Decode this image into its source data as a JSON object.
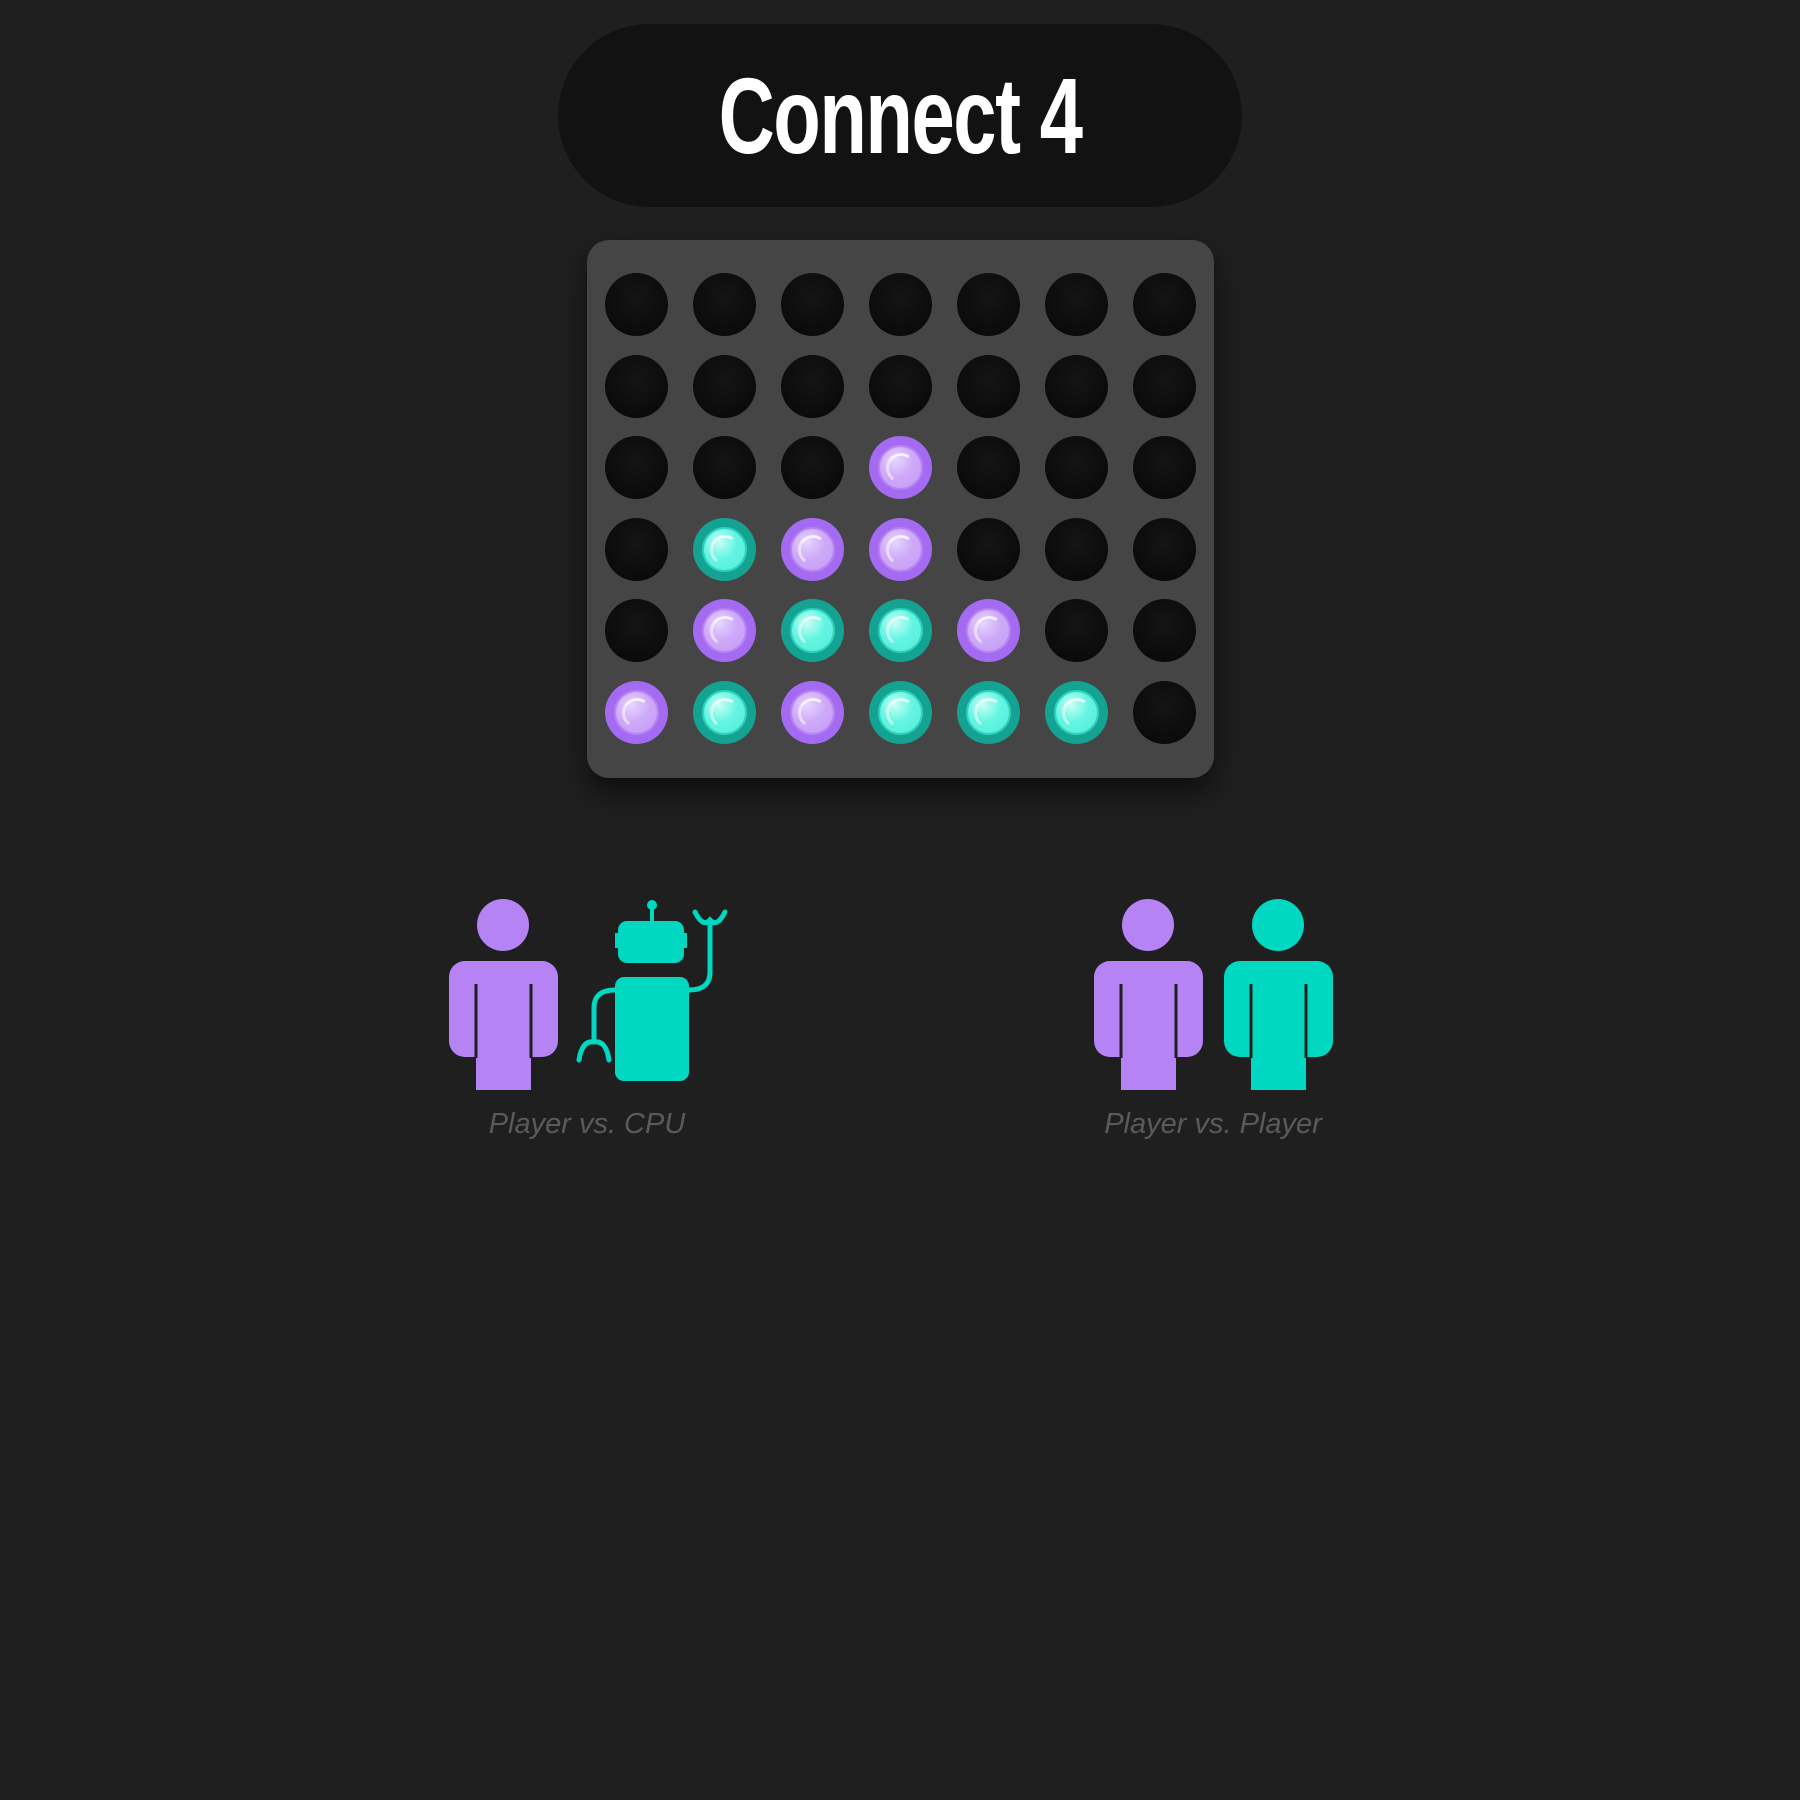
{
  "title": "Connect 4",
  "colors": {
    "background": "#1f1f1f",
    "board": "#454545",
    "player_one": "#b583f4",
    "player_two": "#00d8c2",
    "empty_slot": "#0b0b0b"
  },
  "board": {
    "rows": 6,
    "columns": 7,
    "grid": [
      [
        "empty",
        "empty",
        "empty",
        "empty",
        "empty",
        "empty",
        "empty"
      ],
      [
        "empty",
        "empty",
        "empty",
        "empty",
        "empty",
        "empty",
        "empty"
      ],
      [
        "empty",
        "empty",
        "empty",
        "purple",
        "empty",
        "empty",
        "empty"
      ],
      [
        "empty",
        "teal",
        "purple",
        "purple",
        "empty",
        "empty",
        "empty"
      ],
      [
        "empty",
        "purple",
        "teal",
        "teal",
        "purple",
        "empty",
        "empty"
      ],
      [
        "purple",
        "teal",
        "purple",
        "teal",
        "teal",
        "teal",
        "empty"
      ]
    ]
  },
  "modes": [
    {
      "label": "Player vs. CPU",
      "icons": [
        "person-icon",
        "robot-icon"
      ]
    },
    {
      "label": "Player vs. Player",
      "icons": [
        "person-icon",
        "person-icon"
      ]
    }
  ]
}
